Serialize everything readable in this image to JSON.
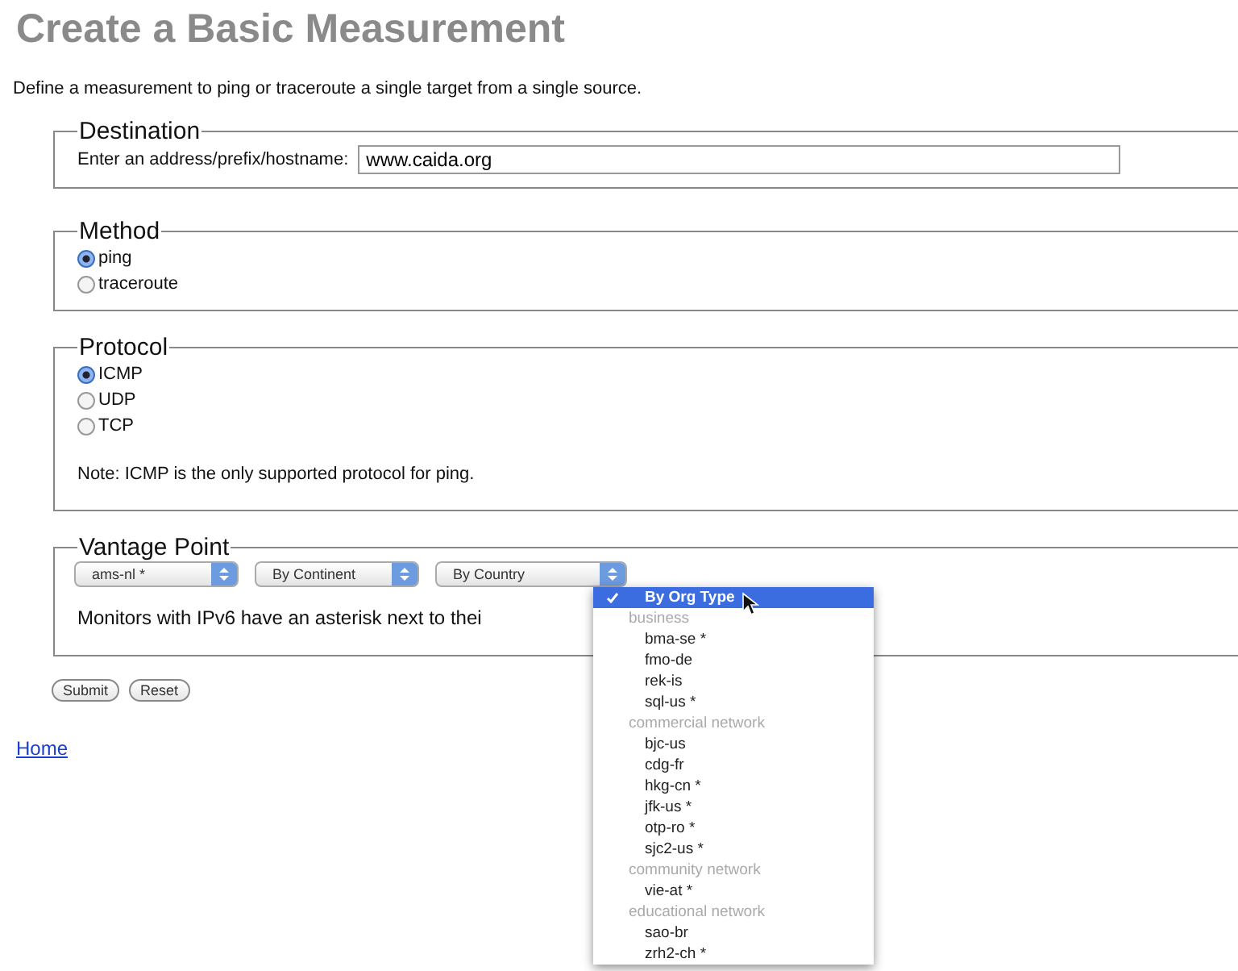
{
  "title": "Create a Basic Measurement",
  "description": "Define a measurement to ping or traceroute a single target from a single source.",
  "destination": {
    "legend": "Destination",
    "label": "Enter an address/prefix/hostname:",
    "value": "www.caida.org"
  },
  "method": {
    "legend": "Method",
    "options": [
      {
        "label": "ping",
        "selected": true
      },
      {
        "label": "traceroute",
        "selected": false
      }
    ]
  },
  "protocol": {
    "legend": "Protocol",
    "options": [
      {
        "label": "ICMP",
        "selected": true
      },
      {
        "label": "UDP",
        "selected": false
      },
      {
        "label": "TCP",
        "selected": false
      }
    ],
    "note": "Note: ICMP is the only supported protocol for ping."
  },
  "vantage_point": {
    "legend": "Vantage Point",
    "selects": [
      "ams-nl *",
      "By Continent",
      "By Country"
    ],
    "note": "Monitors with IPv6 have an asterisk next to thei"
  },
  "buttons": [
    "Submit",
    "Reset"
  ],
  "home_link": "Home",
  "menu": [
    {
      "kind": "option",
      "label": "By Org Type",
      "selected": true
    },
    {
      "kind": "group",
      "label": "business"
    },
    {
      "kind": "option",
      "label": "bma-se *",
      "selected": false
    },
    {
      "kind": "option",
      "label": "fmo-de",
      "selected": false
    },
    {
      "kind": "option",
      "label": "rek-is",
      "selected": false
    },
    {
      "kind": "option",
      "label": "sql-us *",
      "selected": false
    },
    {
      "kind": "group",
      "label": "commercial network"
    },
    {
      "kind": "option",
      "label": "bjc-us",
      "selected": false
    },
    {
      "kind": "option",
      "label": "cdg-fr",
      "selected": false
    },
    {
      "kind": "option",
      "label": "hkg-cn *",
      "selected": false
    },
    {
      "kind": "option",
      "label": "jfk-us *",
      "selected": false
    },
    {
      "kind": "option",
      "label": "otp-ro *",
      "selected": false
    },
    {
      "kind": "option",
      "label": "sjc2-us *",
      "selected": false
    },
    {
      "kind": "group",
      "label": "community network"
    },
    {
      "kind": "option",
      "label": "vie-at *",
      "selected": false
    },
    {
      "kind": "group",
      "label": "educational network"
    },
    {
      "kind": "option",
      "label": "sao-br",
      "selected": false
    },
    {
      "kind": "option",
      "label": "zrh2-ch *",
      "selected": false
    }
  ]
}
